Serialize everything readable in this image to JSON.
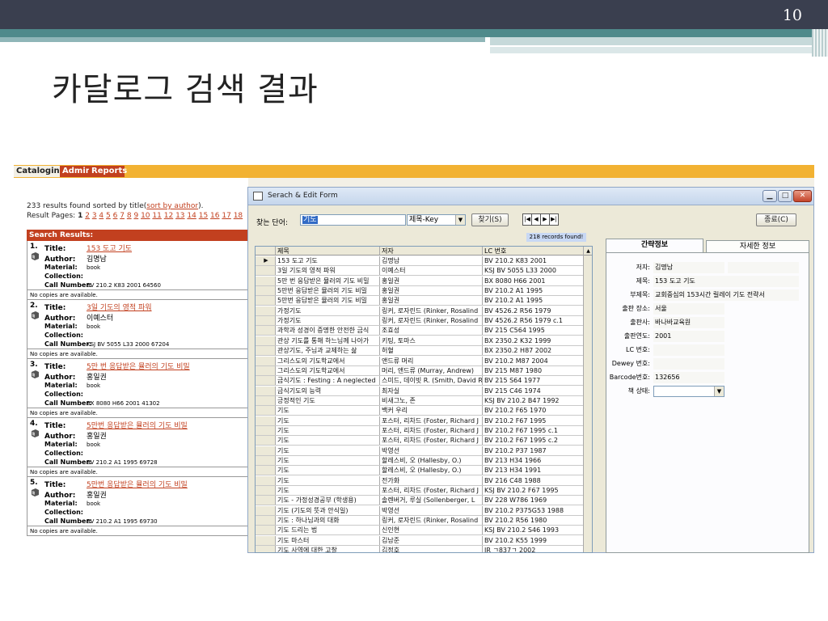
{
  "slide": {
    "page_number": "10",
    "title": "카달로그 검색 결과"
  },
  "app_tabs": [
    {
      "label": "Cataloging"
    },
    {
      "label": "Admin"
    },
    {
      "label": "Reports"
    }
  ],
  "results": {
    "count_text": "233 results found sorted by title(",
    "sort_link": "sort by author",
    "count_suffix": ").",
    "pages_label": "Result Pages:",
    "current_page": "1",
    "pages": [
      "2",
      "3",
      "4",
      "5",
      "6",
      "7",
      "8",
      "9",
      "10",
      "11",
      "12",
      "13",
      "14",
      "15",
      "16",
      "17",
      "18"
    ],
    "header": "Search Results:",
    "labels": {
      "title": "Title:",
      "author": "Author:",
      "material": "Material:",
      "collection": "Collection:",
      "call_number": "Call Number:"
    },
    "items": [
      {
        "num": "1.",
        "title": "153 도고 기도",
        "author": "김명남",
        "material": "book",
        "collection": "",
        "call_number": "BV 210.2 K83 2001 64560",
        "availability": "No copies are available."
      },
      {
        "num": "2.",
        "title": "3일 기도의 영적 파워",
        "author": "이예스터",
        "material": "book",
        "collection": "",
        "call_number": "KSJ BV 5055 L33 2000 67204",
        "availability": "No copies are available."
      },
      {
        "num": "3.",
        "title": "5만 번 응답받은 뮬러의 기도 비밀",
        "author": "홍일권",
        "material": "book",
        "collection": "",
        "call_number": "BX 8080 H66 2001 41302",
        "availability": "No copies are available."
      },
      {
        "num": "4.",
        "title": "5만번 응답받은 뮬러의 기도 비밀",
        "author": "홍일권",
        "material": "book",
        "collection": "",
        "call_number": "BV 210.2 A1 1995 69728",
        "availability": "No copies are available."
      },
      {
        "num": "5.",
        "title": "5만번 응답받은 뮬러의 기도 비밀",
        "author": "홍일권",
        "material": "book",
        "collection": "",
        "call_number": "BV 210.2 A1 1995 69730",
        "availability": "No copies are available."
      }
    ]
  },
  "dialog": {
    "title": "Serach & Edit Form",
    "find_label": "찾는 단어:",
    "find_value": "기도",
    "field_select": "제목-Key",
    "find_button": "찾기(S)",
    "nav_buttons": [
      "|◀",
      "◀",
      "▶",
      "▶|"
    ],
    "close_button": "종료(C)",
    "records_found": "218 records found!",
    "window_buttons": {
      "minimize": "▁",
      "maximize": "□",
      "close": "✕"
    },
    "columns": [
      "제목",
      "저자",
      "LC 번호"
    ],
    "rows": [
      [
        "153 도고 기도",
        "김명남",
        "BV 210.2 K83 2001"
      ],
      [
        "3일 기도의 영적 파워",
        "이예스터",
        "KSJ BV 5055 L33 2000"
      ],
      [
        "5만 번 응답받은 뮬러의 기도 비밀",
        "홍일권",
        "BX 8080 H66 2001"
      ],
      [
        "5만번 응답받은 뮬러의 기도 비밀",
        "홍일권",
        "BV 210.2 A1 1995"
      ],
      [
        "5만번 응답받은 뮬러의 기도 비밀",
        "홍일권",
        "BV 210.2 A1 1995"
      ],
      [
        "가정기도",
        "링커, 로자린드 (Rinker, Rosalind",
        "BV 4526.2 R56 1979"
      ],
      [
        "가정기도",
        "링커, 로자린드 (Rinker, Rosalind",
        "BV 4526.2 R56 1979 c.1"
      ],
      [
        "과학과 성경이 증명한 안전한 금식",
        "조효성",
        "BV 215 C564 1995"
      ],
      [
        "관상 기도를 통해 하느님께 나아가",
        "키팅, 토마스",
        "BX 2350.2 K32 1999"
      ],
      [
        "관상기도, 주님과 교제하는 삶",
        "허혈",
        "BX 2350.2 H87 2002"
      ],
      [
        "그리스도의 기도학교에서",
        "앤드류 머리",
        "BV 210.2 M87 2004"
      ],
      [
        "그리스도의 기도학교에서",
        "머리, 앤드류 (Murray, Andrew)",
        "BV 215 M87 1980"
      ],
      [
        "금식기도 : Festing : A neglected",
        "스미드, 데이빗 R. (Smith, David R",
        "BV 215 S64 1977"
      ],
      [
        "금식기도의 능력",
        "최자실",
        "BV 215 C46 1974"
      ],
      [
        "긍정적인 기도",
        "비새그노, 존",
        "KSJ BV 210.2 B47 1992"
      ],
      [
        "기도",
        "백커 우리",
        "BV 210.2 F65 1970"
      ],
      [
        "기도",
        "포스터, 리차드 (Foster, Richard J",
        "BV 210.2 F67 1995"
      ],
      [
        "기도",
        "포스터, 리차드 (Foster, Richard J",
        "BV 210.2 F67 1995 c.1"
      ],
      [
        "기도",
        "포스터, 리차드 (Foster, Richard J",
        "BV 210.2 F67 1995 c.2"
      ],
      [
        "기도",
        "박영선",
        "BV 210.2 P37 1987"
      ],
      [
        "기도",
        "할레스비, 오 (Hallesby, O.)",
        "BV 213 H34 1966"
      ],
      [
        "기도",
        "할레스비, 오 (Hallesby, O.)",
        "BV 213 H34 1991"
      ],
      [
        "기도",
        "전가화",
        "BV 216 C48 1988"
      ],
      [
        "기도",
        "포스터, 리차드 (Foster, Richard J",
        "KSJ BV 210.2 F67 1995"
      ],
      [
        "기도 - 가정성경공부 (학생용)",
        "솔렌버거, 루실 (Sollenberger, L",
        "BV 228 W786 1969"
      ],
      [
        "기도 (기도의 뜻과 안식일)",
        "박영선",
        "BV 210.2 P375G53 1988"
      ],
      [
        "기도 : 하나님과의 대화",
        "링커, 로자린드 (Rinker, Rosalind",
        "BV 210.2 R56 1980"
      ],
      [
        "기도 드리는 법",
        "신인현",
        "KSJ BV 210.2 S46 1993"
      ],
      [
        "기도 마스터",
        "김남준",
        "BV 210.2 K55 1999"
      ],
      [
        "기도 사역에 대한 고찰",
        "김정호",
        "IR ㄱ837ㄱ 2002"
      ]
    ],
    "info_tabs": [
      "간략정보",
      "자세한 정보"
    ],
    "info": {
      "author_label": "저자:",
      "author": "김명남",
      "title_label": "제목:",
      "title": "153 도고 기도",
      "subtitle_label": "부제목:",
      "subtitle": "교회중심의 153시간 릴레이 기도 전략서",
      "place_label": "출판 장소:",
      "place": "서울",
      "publisher_label": "출판사:",
      "publisher": "바나바교육원",
      "year_label": "출판연도:",
      "year": "2001",
      "lc_label": "LC 번호:",
      "lc": "",
      "dewey_label": "Dewey 번호:",
      "dewey": "",
      "barcode_label": "Barcode번호:",
      "barcode": "132656",
      "status_label": "책 상태:",
      "status": ""
    }
  }
}
